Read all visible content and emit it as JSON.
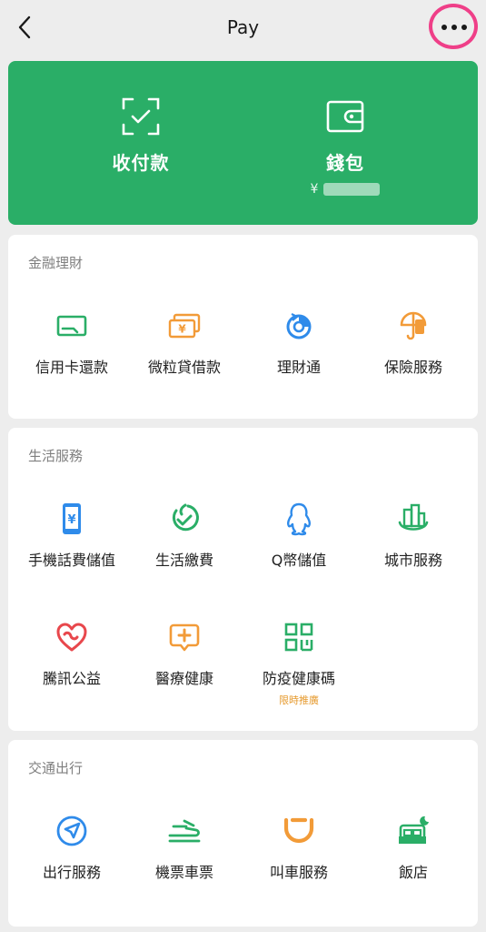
{
  "header": {
    "title": "Pay"
  },
  "top_actions": {
    "receive_pay": {
      "label": "收付款",
      "icon": "scan-check-icon"
    },
    "wallet": {
      "label": "錢包",
      "currency": "¥",
      "icon": "wallet-icon"
    }
  },
  "sections": [
    {
      "title": "金融理財",
      "items": [
        {
          "label": "信用卡還款",
          "icon": "credit-card-icon",
          "color": "#2aae67"
        },
        {
          "label": "微粒貸借款",
          "icon": "loan-bill-icon",
          "color": "#f29b38"
        },
        {
          "label": "理財通",
          "icon": "wealth-management-icon",
          "color": "#2f8bea"
        },
        {
          "label": "保險服務",
          "icon": "insurance-umbrella-icon",
          "color": "#f29b38"
        }
      ]
    },
    {
      "title": "生活服務",
      "items": [
        {
          "label": "手機話費儲值",
          "icon": "phone-topup-icon",
          "color": "#2f8bea"
        },
        {
          "label": "生活繳費",
          "icon": "utility-payment-icon",
          "color": "#2aae67"
        },
        {
          "label": "Q幣儲值",
          "icon": "qq-penguin-icon",
          "color": "#2f8bea"
        },
        {
          "label": "城市服務",
          "icon": "city-buildings-icon",
          "color": "#2aae67"
        },
        {
          "label": "騰訊公益",
          "icon": "charity-heart-icon",
          "color": "#e8474c"
        },
        {
          "label": "醫療健康",
          "icon": "medical-cross-icon",
          "color": "#f29b38"
        },
        {
          "label": "防疫健康碼",
          "sub": "限時推廣",
          "icon": "qr-code-icon",
          "color": "#2aae67"
        }
      ]
    },
    {
      "title": "交通出行",
      "items": [
        {
          "label": "出行服務",
          "icon": "navigation-arrow-icon",
          "color": "#2f8bea"
        },
        {
          "label": "機票車票",
          "icon": "train-ticket-icon",
          "color": "#2aae67"
        },
        {
          "label": "叫車服務",
          "icon": "ride-hailing-icon",
          "color": "#f29b38"
        },
        {
          "label": "飯店",
          "icon": "hotel-bed-icon",
          "color": "#2aae67"
        }
      ]
    }
  ]
}
